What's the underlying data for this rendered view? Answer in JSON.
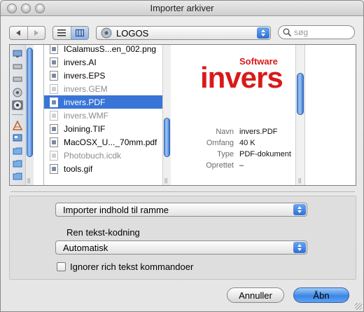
{
  "window": {
    "title": "Importer arkiver"
  },
  "toolbar": {
    "location_label": "LOGOS",
    "search_placeholder": "søg"
  },
  "file_list": [
    {
      "name": "ICalamusS...en_002.png",
      "state": "normal"
    },
    {
      "name": "invers.AI",
      "state": "normal"
    },
    {
      "name": "invers.EPS",
      "state": "normal"
    },
    {
      "name": "invers.GEM",
      "state": "dim"
    },
    {
      "name": "invers.PDF",
      "state": "selected"
    },
    {
      "name": "invers.WMF",
      "state": "dim"
    },
    {
      "name": "Joining.TIF",
      "state": "normal"
    },
    {
      "name": "MacOSX_U..._70mm.pdf",
      "state": "normal"
    },
    {
      "name": "Photobuch.icdk",
      "state": "dim"
    },
    {
      "name": "tools.gif",
      "state": "normal"
    }
  ],
  "preview": {
    "logo_small": "Software",
    "logo_main": "invers",
    "meta": [
      {
        "key": "Navn",
        "value": "invers.PDF"
      },
      {
        "key": "Omfang",
        "value": "40 K"
      },
      {
        "key": "Type",
        "value": "PDF-dokument"
      },
      {
        "key": "Oprettet",
        "value": "–"
      }
    ]
  },
  "options": {
    "import_mode": "Importer indhold til ramme",
    "encoding_label": "Ren tekst-kodning",
    "encoding_value": "Automatisk",
    "ignore_rich_text_label": "Ignorer rich tekst kommandoer",
    "ignore_rich_text_checked": false
  },
  "buttons": {
    "cancel": "Annuller",
    "open": "Åbn"
  },
  "colors": {
    "selection": "#3875d7",
    "brand_red": "#d91a1a",
    "aqua_blue": "#3c86e5"
  }
}
